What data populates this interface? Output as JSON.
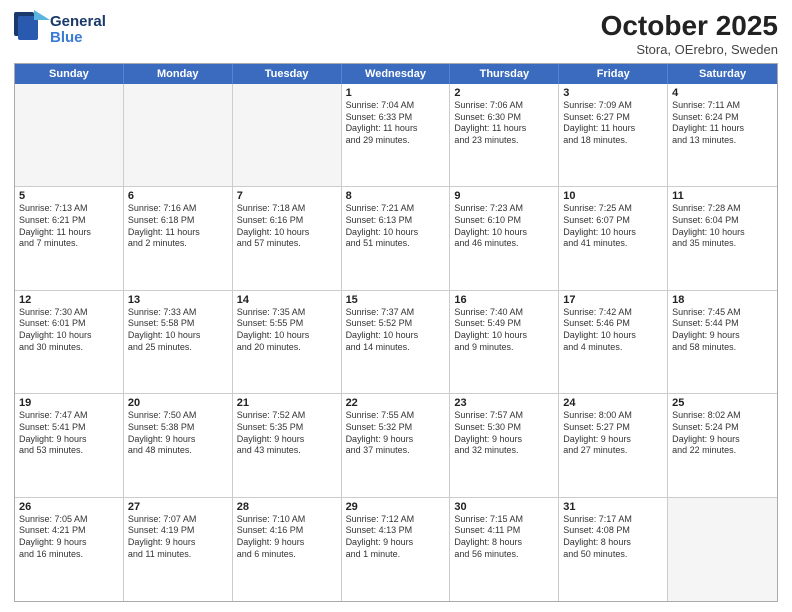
{
  "header": {
    "logo_line1": "General",
    "logo_line2": "Blue",
    "month_title": "October 2025",
    "location": "Stora, OErebro, Sweden"
  },
  "weekdays": [
    "Sunday",
    "Monday",
    "Tuesday",
    "Wednesday",
    "Thursday",
    "Friday",
    "Saturday"
  ],
  "rows": [
    [
      {
        "day": "",
        "text": ""
      },
      {
        "day": "",
        "text": ""
      },
      {
        "day": "",
        "text": ""
      },
      {
        "day": "1",
        "text": "Sunrise: 7:04 AM\nSunset: 6:33 PM\nDaylight: 11 hours\nand 29 minutes."
      },
      {
        "day": "2",
        "text": "Sunrise: 7:06 AM\nSunset: 6:30 PM\nDaylight: 11 hours\nand 23 minutes."
      },
      {
        "day": "3",
        "text": "Sunrise: 7:09 AM\nSunset: 6:27 PM\nDaylight: 11 hours\nand 18 minutes."
      },
      {
        "day": "4",
        "text": "Sunrise: 7:11 AM\nSunset: 6:24 PM\nDaylight: 11 hours\nand 13 minutes."
      }
    ],
    [
      {
        "day": "5",
        "text": "Sunrise: 7:13 AM\nSunset: 6:21 PM\nDaylight: 11 hours\nand 7 minutes."
      },
      {
        "day": "6",
        "text": "Sunrise: 7:16 AM\nSunset: 6:18 PM\nDaylight: 11 hours\nand 2 minutes."
      },
      {
        "day": "7",
        "text": "Sunrise: 7:18 AM\nSunset: 6:16 PM\nDaylight: 10 hours\nand 57 minutes."
      },
      {
        "day": "8",
        "text": "Sunrise: 7:21 AM\nSunset: 6:13 PM\nDaylight: 10 hours\nand 51 minutes."
      },
      {
        "day": "9",
        "text": "Sunrise: 7:23 AM\nSunset: 6:10 PM\nDaylight: 10 hours\nand 46 minutes."
      },
      {
        "day": "10",
        "text": "Sunrise: 7:25 AM\nSunset: 6:07 PM\nDaylight: 10 hours\nand 41 minutes."
      },
      {
        "day": "11",
        "text": "Sunrise: 7:28 AM\nSunset: 6:04 PM\nDaylight: 10 hours\nand 35 minutes."
      }
    ],
    [
      {
        "day": "12",
        "text": "Sunrise: 7:30 AM\nSunset: 6:01 PM\nDaylight: 10 hours\nand 30 minutes."
      },
      {
        "day": "13",
        "text": "Sunrise: 7:33 AM\nSunset: 5:58 PM\nDaylight: 10 hours\nand 25 minutes."
      },
      {
        "day": "14",
        "text": "Sunrise: 7:35 AM\nSunset: 5:55 PM\nDaylight: 10 hours\nand 20 minutes."
      },
      {
        "day": "15",
        "text": "Sunrise: 7:37 AM\nSunset: 5:52 PM\nDaylight: 10 hours\nand 14 minutes."
      },
      {
        "day": "16",
        "text": "Sunrise: 7:40 AM\nSunset: 5:49 PM\nDaylight: 10 hours\nand 9 minutes."
      },
      {
        "day": "17",
        "text": "Sunrise: 7:42 AM\nSunset: 5:46 PM\nDaylight: 10 hours\nand 4 minutes."
      },
      {
        "day": "18",
        "text": "Sunrise: 7:45 AM\nSunset: 5:44 PM\nDaylight: 9 hours\nand 58 minutes."
      }
    ],
    [
      {
        "day": "19",
        "text": "Sunrise: 7:47 AM\nSunset: 5:41 PM\nDaylight: 9 hours\nand 53 minutes."
      },
      {
        "day": "20",
        "text": "Sunrise: 7:50 AM\nSunset: 5:38 PM\nDaylight: 9 hours\nand 48 minutes."
      },
      {
        "day": "21",
        "text": "Sunrise: 7:52 AM\nSunset: 5:35 PM\nDaylight: 9 hours\nand 43 minutes."
      },
      {
        "day": "22",
        "text": "Sunrise: 7:55 AM\nSunset: 5:32 PM\nDaylight: 9 hours\nand 37 minutes."
      },
      {
        "day": "23",
        "text": "Sunrise: 7:57 AM\nSunset: 5:30 PM\nDaylight: 9 hours\nand 32 minutes."
      },
      {
        "day": "24",
        "text": "Sunrise: 8:00 AM\nSunset: 5:27 PM\nDaylight: 9 hours\nand 27 minutes."
      },
      {
        "day": "25",
        "text": "Sunrise: 8:02 AM\nSunset: 5:24 PM\nDaylight: 9 hours\nand 22 minutes."
      }
    ],
    [
      {
        "day": "26",
        "text": "Sunrise: 7:05 AM\nSunset: 4:21 PM\nDaylight: 9 hours\nand 16 minutes."
      },
      {
        "day": "27",
        "text": "Sunrise: 7:07 AM\nSunset: 4:19 PM\nDaylight: 9 hours\nand 11 minutes."
      },
      {
        "day": "28",
        "text": "Sunrise: 7:10 AM\nSunset: 4:16 PM\nDaylight: 9 hours\nand 6 minutes."
      },
      {
        "day": "29",
        "text": "Sunrise: 7:12 AM\nSunset: 4:13 PM\nDaylight: 9 hours\nand 1 minute."
      },
      {
        "day": "30",
        "text": "Sunrise: 7:15 AM\nSunset: 4:11 PM\nDaylight: 8 hours\nand 56 minutes."
      },
      {
        "day": "31",
        "text": "Sunrise: 7:17 AM\nSunset: 4:08 PM\nDaylight: 8 hours\nand 50 minutes."
      },
      {
        "day": "",
        "text": ""
      }
    ]
  ]
}
